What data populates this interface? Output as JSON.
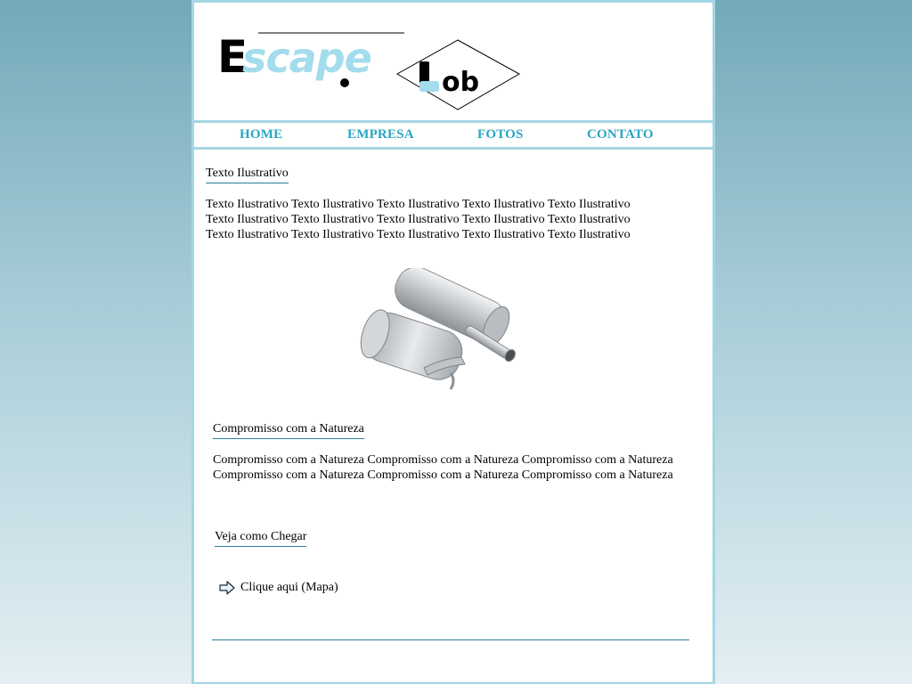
{
  "logo": {
    "text_part1": "Escape",
    "text_part2": "Lob",
    "colors": {
      "dark": "#000000",
      "light": "#a3dcec"
    }
  },
  "nav": {
    "items": [
      {
        "label": "HOME"
      },
      {
        "label": "EMPRESA"
      },
      {
        "label": "FOTOS"
      },
      {
        "label": "CONTATO"
      }
    ],
    "color": "#2aa4c4"
  },
  "section1": {
    "title": "Texto Ilustrativo",
    "lines": [
      "Texto Ilustrativo Texto Ilustrativo Texto Ilustrativo Texto Ilustrativo Texto Ilustrativo",
      "Texto Ilustrativo Texto Ilustrativo Texto Ilustrativo Texto Ilustrativo Texto Ilustrativo",
      "Texto Ilustrativo Texto Ilustrativo Texto Ilustrativo Texto Ilustrativo Texto Ilustrativo"
    ]
  },
  "photo": {
    "subject": "muffler-image"
  },
  "section2": {
    "title": "Compromisso com a Natureza",
    "lines": [
      "Compromisso com a Natureza Compromisso com a Natureza Compromisso com a Natureza",
      "Compromisso com a Natureza Compromisso com a Natureza Compromisso com a Natureza"
    ]
  },
  "section3": {
    "title": "Veja como Chegar",
    "link_label": "Clique aqui (Mapa)",
    "link_icon": "arrow-right-icon"
  },
  "colors": {
    "frame_border": "#a4d6e4",
    "underline": "#2a7f9b",
    "background_top": "#73a9b9",
    "background_bottom": "#e3eff3"
  }
}
